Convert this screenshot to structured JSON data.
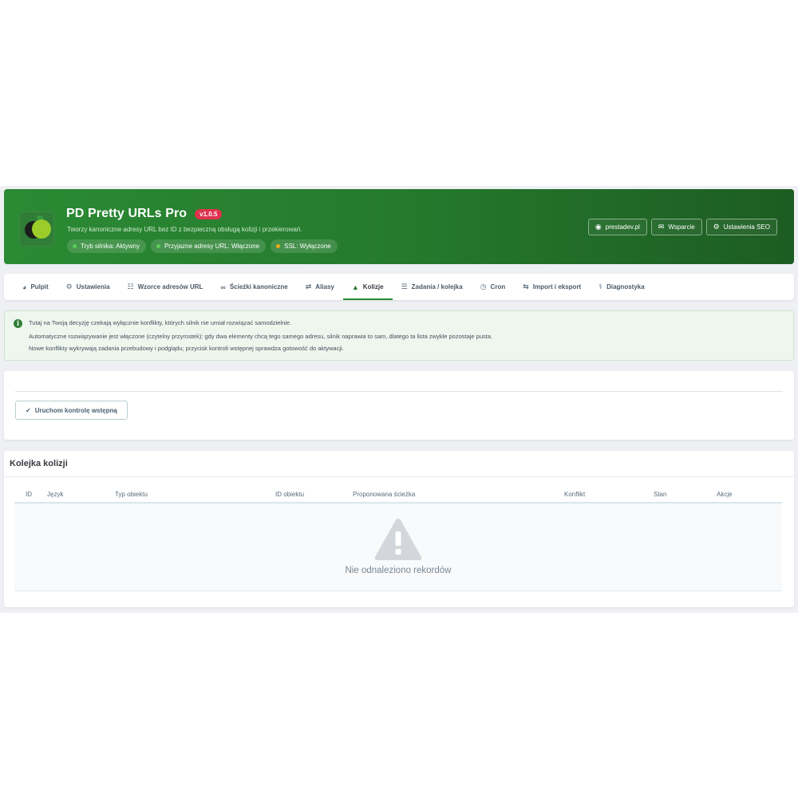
{
  "header": {
    "title": "PD Pretty URLs Pro",
    "version": "v1.0.5",
    "subtitle": "Tworzy kanoniczne adresy URL bez ID z bezpieczną obsługą kolizji i przekierowań.",
    "pills": [
      {
        "label": "Tryb silnika: Aktywny",
        "color": "#5ccd5c"
      },
      {
        "label": "Przyjazne adresy URL: Włączone",
        "color": "#5ccd5c"
      },
      {
        "label": "SSL: Wyłączone",
        "color": "#f0a818"
      }
    ],
    "buttons": [
      {
        "label": "prestadev.pl",
        "icon": "globe-icon"
      },
      {
        "label": "Wsparcie",
        "icon": "envelope-icon"
      },
      {
        "label": "Ustawienia SEO",
        "icon": "cogs-icon"
      }
    ]
  },
  "tabs": [
    {
      "label": "Pulpit",
      "icon": "dashboard-icon",
      "active": false
    },
    {
      "label": "Ustawienia",
      "icon": "cogs-icon",
      "active": false
    },
    {
      "label": "Wzorce adresów URL",
      "icon": "sitemap-icon",
      "active": false
    },
    {
      "label": "Ścieżki kanoniczne",
      "icon": "link-icon",
      "active": false
    },
    {
      "label": "Aliasy",
      "icon": "random-icon",
      "active": false
    },
    {
      "label": "Kolizje",
      "icon": "warning-icon",
      "active": true
    },
    {
      "label": "Zadania / kolejka",
      "icon": "tasks-icon",
      "active": false
    },
    {
      "label": "Cron",
      "icon": "clock-icon",
      "active": false
    },
    {
      "label": "Import i eksport",
      "icon": "exchange-icon",
      "active": false
    },
    {
      "label": "Diagnostyka",
      "icon": "stethoscope-icon",
      "active": false
    }
  ],
  "alert": {
    "lines": [
      "Tutaj na Twoją decyzję czekają wyłącznie konflikty, których silnik nie umiał rozwiązać samodzielnie.",
      "Automatyczne rozwiązywanie jest włączone (czytelny przyrostek): gdy dwa elementy chcą tego samego adresu, silnik naprawia to sam, dlatego ta lista zwykle pozostaje pusta.",
      "Nowe konflikty wykrywają zadania przebudowy i podglądu; przycisk kontroli wstępnej sprawdza gotowość do aktywacji."
    ]
  },
  "precheck": {
    "button_label": "Uruchom kontrolę wstępną"
  },
  "queue": {
    "title": "Kolejka kolizji",
    "columns": [
      "ID",
      "Język",
      "Typ obiektu",
      "ID obiektu",
      "Proponowana ścieżka",
      "Konflikt",
      "Stan",
      "Akcje"
    ],
    "empty_text": "Nie odnaleziono rekordów"
  },
  "colors": {
    "brand": "#2a8a34",
    "version_badge": "#e0324e"
  }
}
